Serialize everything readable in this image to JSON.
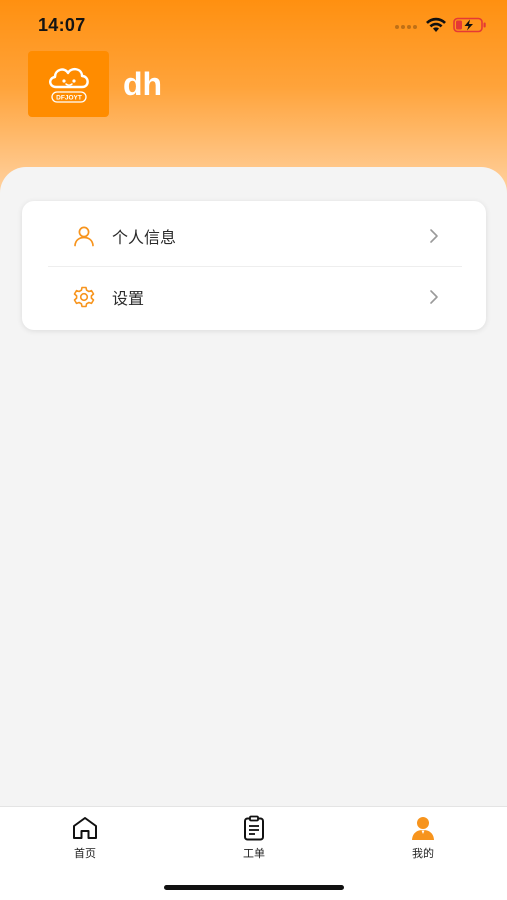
{
  "status_bar": {
    "time": "14:07",
    "icons": [
      "cellular-signal-icon",
      "wifi-icon",
      "battery-charging-icon"
    ]
  },
  "profile": {
    "username": "dh",
    "avatar_logo_text": "DFJOYT",
    "avatar_color": "#ff8c00"
  },
  "menu": {
    "items": [
      {
        "label": "个人信息",
        "icon": "user-icon"
      },
      {
        "label": "设置",
        "icon": "gear-icon"
      }
    ]
  },
  "tabbar": {
    "tabs": [
      {
        "label": "首页",
        "icon": "home-icon",
        "active": false
      },
      {
        "label": "工单",
        "icon": "clipboard-icon",
        "active": false
      },
      {
        "label": "我的",
        "icon": "person-icon",
        "active": true
      }
    ]
  },
  "colors": {
    "accent": "#ff8c00",
    "header_top": "#ff9010",
    "background": "#f4f4f4",
    "text": "#2a2a2a"
  }
}
